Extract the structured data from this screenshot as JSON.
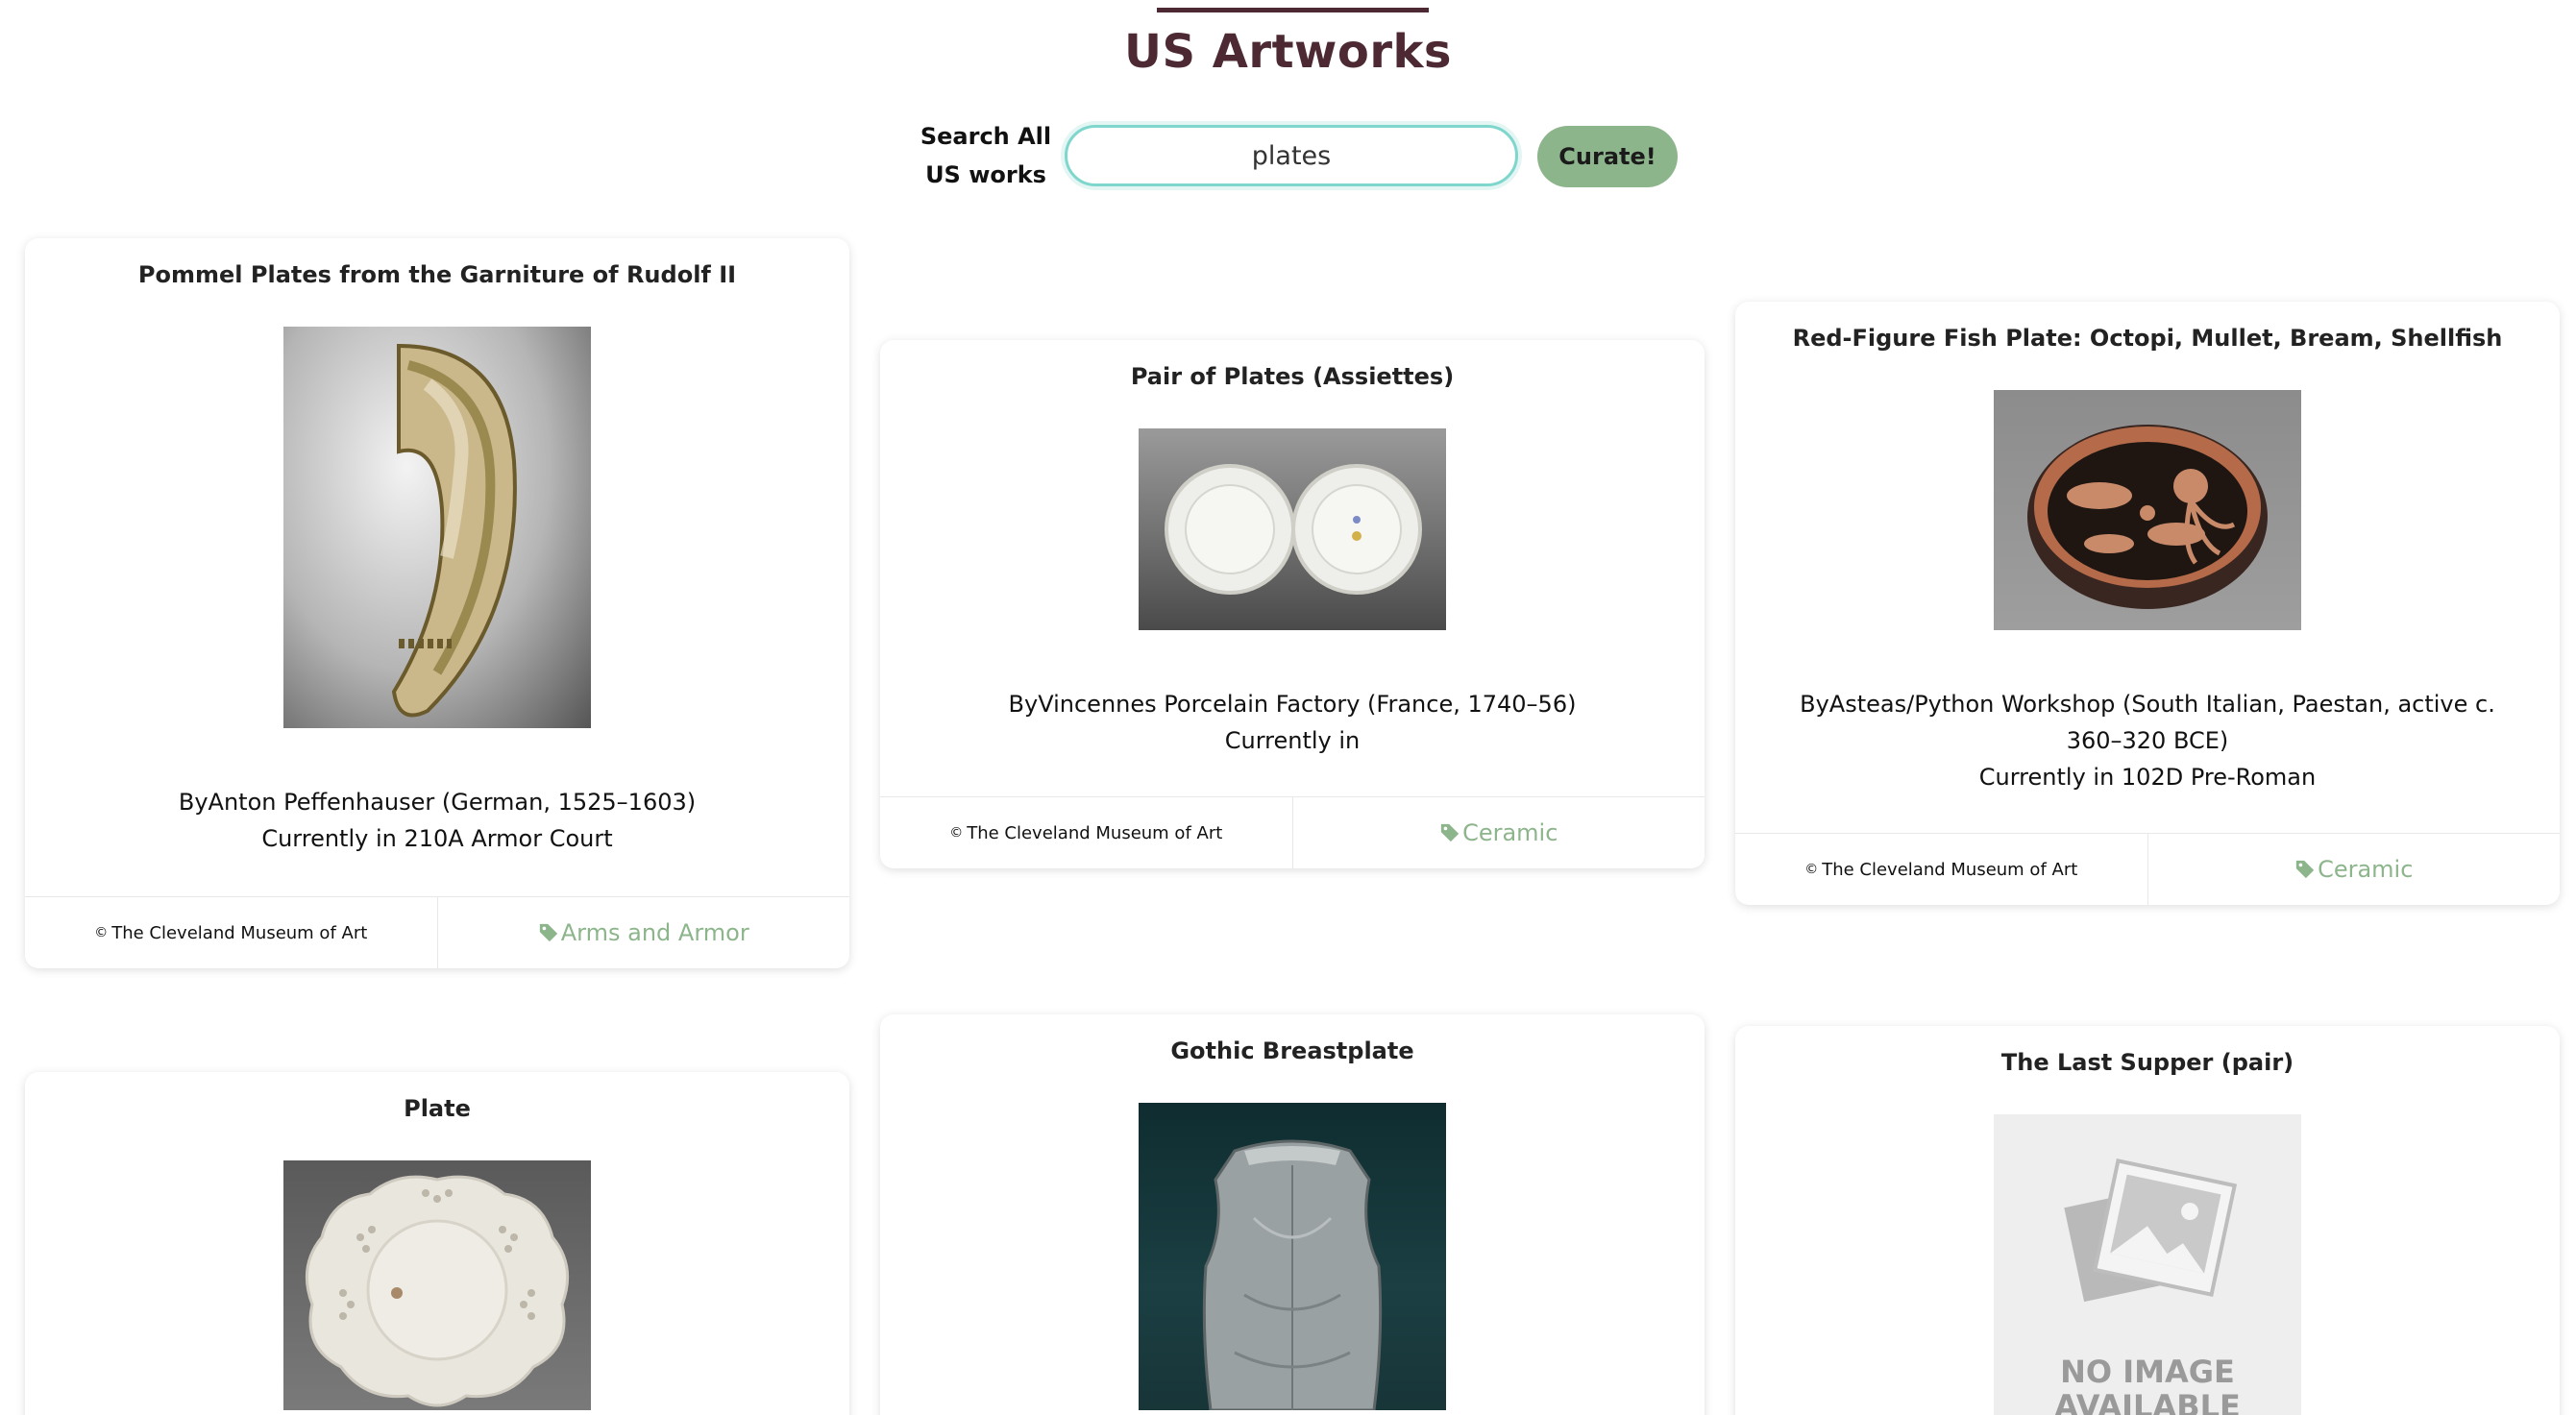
{
  "header": {
    "title": "US Artworks"
  },
  "search": {
    "label": "Search All US works",
    "value": "plates",
    "button_label": "Curate!"
  },
  "copyright": {
    "symbol": "©",
    "label": "The Cleveland Museum of Art"
  },
  "cards": [
    {
      "title": "Pommel Plates from the Garniture of Rudolf II",
      "by": "ByAnton Peffenhauser (German, 1525–1603)",
      "location": "Currently in 210A Armor Court",
      "tag": "Arms and Armor"
    },
    {
      "title": "Pair of Plates (Assiettes)",
      "by": "ByVincennes Porcelain Factory (France, 1740–56)",
      "location": "Currently in",
      "tag": "Ceramic"
    },
    {
      "title": "Red-Figure Fish Plate: Octopi, Mullet, Bream, Shellfish",
      "by": "ByAsteas/Python Workshop (South Italian, Paestan, active c. 360–320 BCE)",
      "location": "Currently in 102D Pre-Roman",
      "tag": "Ceramic"
    },
    {
      "title": "Plate"
    },
    {
      "title": "Gothic Breastplate"
    },
    {
      "title": "The Last Supper (pair)",
      "no_image_line1": "NO IMAGE",
      "no_image_line2": "AVAILABLE"
    }
  ],
  "colors": {
    "title": "#4d2a33",
    "accent_green": "#8db58c",
    "input_border": "#7fd6cd"
  },
  "icons": {
    "tag": "tag-icon",
    "no_image": "photo-placeholder-icon"
  }
}
